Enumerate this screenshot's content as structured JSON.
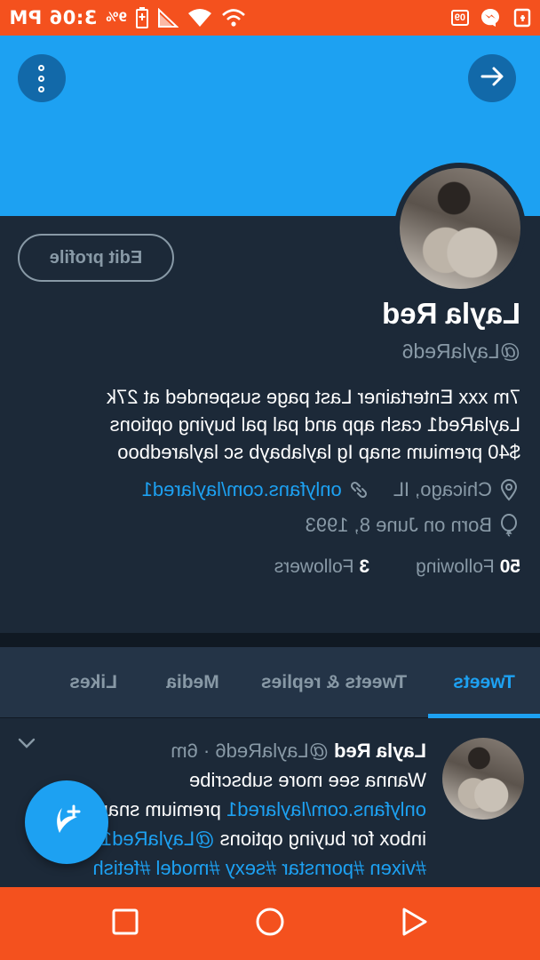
{
  "status_bar": {
    "time": "3:06 PM",
    "battery_label": "9%",
    "small_label": "09",
    "icons": [
      "messenger-icon",
      "notification-icon",
      "battery-icon",
      "wifi-icon",
      "signal-icon",
      "bluetooth-icon"
    ]
  },
  "header": {
    "back_icon": "arrow-back-icon",
    "more_icon": "more-vertical-icon"
  },
  "profile": {
    "edit_button": "Edit profile",
    "name": "Layla Red",
    "handle": "@LaylaRed6",
    "bio": [
      "7m xxx Entertainer Last page suspended at 27k",
      "LaylaRed1 cash app and pal pal buying options",
      "$40 premium snap Ig laylabayb sc laylaredboo"
    ],
    "location": "Chicago, IL",
    "website": "onlyfans.com/laylared1",
    "born": "Born on June 8, 1993",
    "following_count": "50",
    "following_label": "Following",
    "followers_count": "3",
    "followers_label": "Followers"
  },
  "tabs": [
    {
      "label": "Tweets",
      "active": true
    },
    {
      "label": "Tweets & replies",
      "active": false
    },
    {
      "label": "Media",
      "active": false
    },
    {
      "label": "Likes",
      "active": false
    }
  ],
  "tweet": {
    "author": "Layla Red",
    "handle_time": "@LaylaRed6 · 6m",
    "line1": "Wanna see more subscribe",
    "line2_link": "onlyfans.com/laylared1",
    "line2_text": " premium snap or",
    "line3_text": "inbox for buying options ",
    "line3_link": "@LaylaRed1",
    "line4": "#vixen #pornstar #sexy #model #fetish"
  },
  "fab": {
    "icon": "compose-tweet-icon"
  },
  "nav_bar": {
    "icons": [
      "back-triangle-icon",
      "home-circle-icon",
      "recents-square-icon"
    ]
  },
  "colors": {
    "accent": "#1da1f2",
    "background": "#1c2938",
    "system_bar": "#f4511e",
    "muted": "#8899a6"
  }
}
